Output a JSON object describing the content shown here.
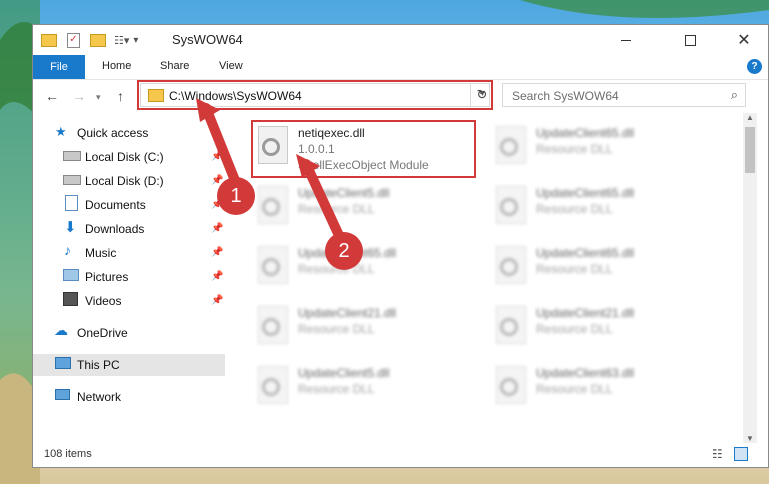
{
  "window": {
    "title": "SysWOW64"
  },
  "ribbon": {
    "file": "File",
    "tabs": [
      "Home",
      "Share",
      "View"
    ],
    "help": "?"
  },
  "nav": {
    "address": "C:\\Windows\\SysWOW64",
    "search_placeholder": "Search SysWOW64"
  },
  "sidebar": {
    "items": [
      {
        "label": "Quick access",
        "icon": "star-icon"
      },
      {
        "label": "Local Disk (C:)",
        "icon": "drive-icon",
        "pinned": true
      },
      {
        "label": "Local Disk (D:)",
        "icon": "drive-icon",
        "pinned": true
      },
      {
        "label": "Documents",
        "icon": "documents-icon",
        "pinned": true
      },
      {
        "label": "Downloads",
        "icon": "downloads-icon",
        "pinned": true
      },
      {
        "label": "Music",
        "icon": "music-icon",
        "pinned": true
      },
      {
        "label": "Pictures",
        "icon": "pictures-icon",
        "pinned": true
      },
      {
        "label": "Videos",
        "icon": "videos-icon",
        "pinned": true
      },
      {
        "label": "OneDrive",
        "icon": "cloud-icon"
      },
      {
        "label": "This PC",
        "icon": "computer-icon",
        "selected": true
      },
      {
        "label": "Network",
        "icon": "network-icon"
      }
    ]
  },
  "files": [
    {
      "name": "netiqexec.dll",
      "version": "1.0.0.1",
      "desc": "ShellExecObject Module",
      "highlighted": true
    },
    {
      "name": "UpdateClient65.dll",
      "version": "Resource DLL",
      "desc": ""
    },
    {
      "name": "UpdateClient5.dll",
      "version": "Resource DLL",
      "desc": ""
    },
    {
      "name": "UpdateClient65.dll",
      "version": "Resource DLL",
      "desc": ""
    },
    {
      "name": "UpdateClient65.dll",
      "version": "Resource DLL",
      "desc": ""
    },
    {
      "name": "UpdateClient65.dll",
      "version": "Resource DLL",
      "desc": ""
    },
    {
      "name": "UpdateClient21.dll",
      "version": "Resource DLL",
      "desc": ""
    },
    {
      "name": "UpdateClient21.dll",
      "version": "Resource DLL",
      "desc": ""
    },
    {
      "name": "UpdateClient5.dll",
      "version": "Resource DLL",
      "desc": ""
    },
    {
      "name": "UpdateClient63.dll",
      "version": "Resource DLL",
      "desc": ""
    }
  ],
  "status": {
    "items": "108 items"
  },
  "annotations": {
    "step1": "1",
    "step2": "2"
  },
  "colors": {
    "accent": "#1979ca",
    "highlight": "#d23a3a"
  }
}
